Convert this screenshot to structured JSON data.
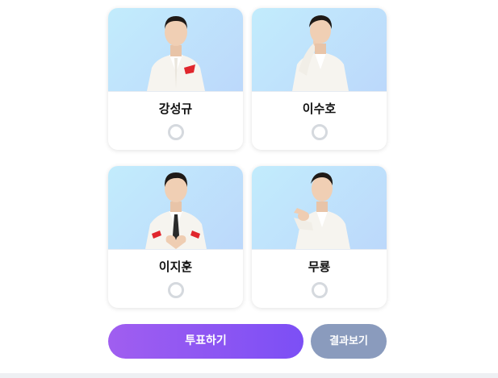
{
  "candidates": [
    {
      "name": "강성규",
      "pose": "pocket-square"
    },
    {
      "name": "이수호",
      "pose": "finger-on-lips"
    },
    {
      "name": "이지훈",
      "pose": "heart-hands"
    },
    {
      "name": "무룡",
      "pose": "pointing"
    }
  ],
  "actions": {
    "vote_label": "투표하기",
    "results_label": "결과보기"
  },
  "colors": {
    "vote_gradient": [
      "#a05ef0",
      "#7c4ff5"
    ],
    "results_bg": "#8a9bbd",
    "photo_bg": [
      "#c2ecfc",
      "#bcd8fb"
    ],
    "radio_border": "#d5d9de"
  }
}
